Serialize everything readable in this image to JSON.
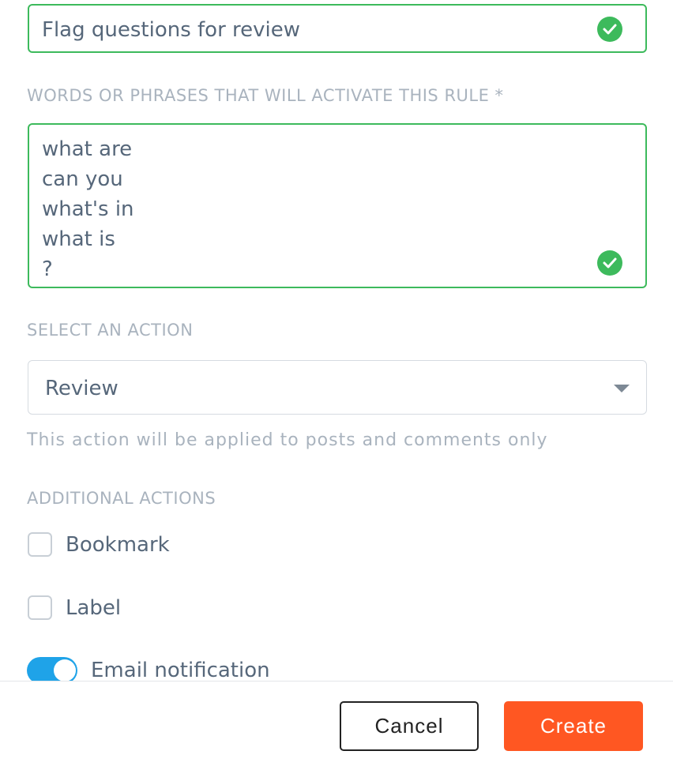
{
  "rule_name": {
    "value": "Flag questions for review",
    "icon": "check-circle-icon"
  },
  "phrases": {
    "label": "WORDS OR PHRASES THAT WILL ACTIVATE THIS RULE *",
    "lines": [
      "what are",
      "can you",
      "what's in",
      "what is",
      "?"
    ],
    "icon": "check-circle-icon"
  },
  "action": {
    "label": "SELECT AN ACTION",
    "selected": "Review",
    "hint": "This action will be applied to posts and comments only"
  },
  "additional": {
    "label": "ADDITIONAL ACTIONS",
    "bookmark": {
      "label": "Bookmark",
      "checked": false
    },
    "label_option": {
      "label": "Label",
      "checked": false
    },
    "email": {
      "label": "Email notification",
      "enabled": true
    }
  },
  "footer": {
    "cancel_label": "Cancel",
    "create_label": "Create"
  },
  "colors": {
    "valid_green": "#3dba5c",
    "toggle_blue": "#1fa3e8",
    "create_orange": "#ff5722"
  }
}
